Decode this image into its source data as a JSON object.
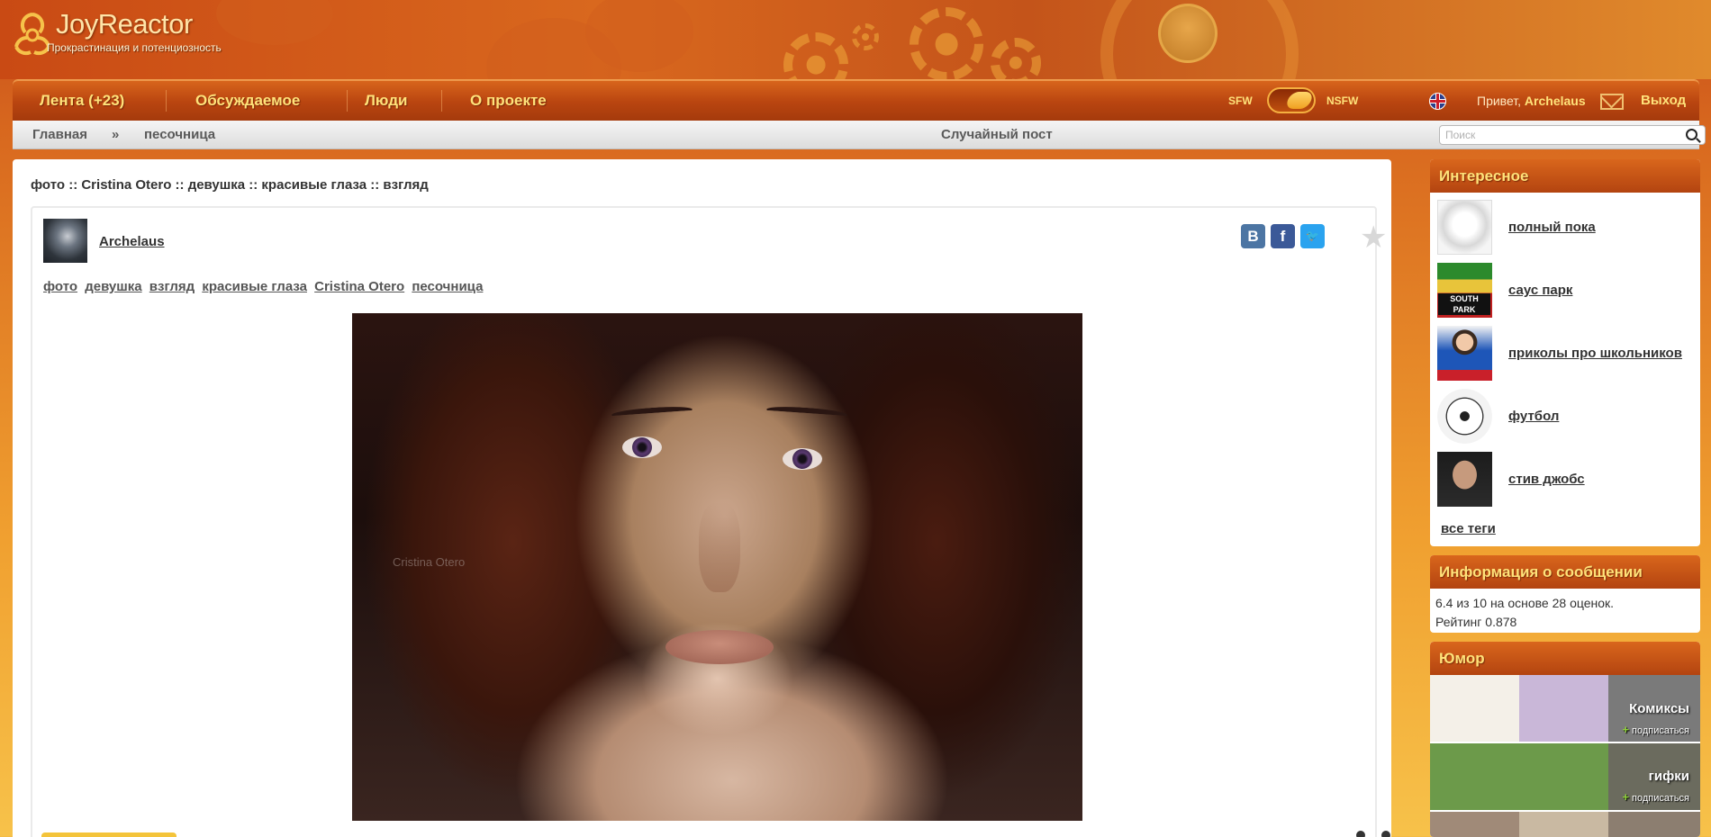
{
  "header": {
    "logo_title": "JoyReactor",
    "logo_subtitle": "Прокрастинация и потенциозность"
  },
  "nav": {
    "items": [
      {
        "label": "Лента (+23)"
      },
      {
        "label": "Обсуждаемое"
      },
      {
        "label": "Люди"
      },
      {
        "label": "О проекте"
      }
    ],
    "sfw_label": "SFW",
    "nsfw_label": "NSFW",
    "greeting": "Привет,",
    "username": "Archelaus",
    "logout_label": "Выход"
  },
  "crumbs": {
    "home": "Главная",
    "separator": "»",
    "current": "песочница",
    "random_post": "Случайный пост",
    "search_placeholder": "Поиск"
  },
  "post": {
    "title": "фото :: Cristina Otero :: девушка :: красивые глаза :: взгляд",
    "author": "Archelaus",
    "tags": [
      "фото",
      "девушка",
      "взгляд",
      "красивые глаза",
      "Cristina Otero",
      "песочница"
    ],
    "share": {
      "vk": "B",
      "fb": "f",
      "tw": "🐦"
    },
    "watermark": "Cristina Otero"
  },
  "sidebar": {
    "interesting": {
      "title": "Интересное",
      "items": [
        {
          "label": "полный пока"
        },
        {
          "label": "саус парк"
        },
        {
          "label": "приколы про школьников"
        },
        {
          "label": "футбол"
        },
        {
          "label": "стив джобс"
        }
      ],
      "all_tags": "все теги"
    },
    "info": {
      "title": "Информация о сообщении",
      "line1": "6.4 из 10 на основе 28 оценок.",
      "line2": "Рейтинг 0.878"
    },
    "humor": {
      "title": "Юмор",
      "items": [
        {
          "title": "Комиксы",
          "subscribe": "подписаться"
        },
        {
          "title": "гифки",
          "subscribe": "подписаться"
        }
      ]
    }
  },
  "colors": {
    "accent": "#ffe27a",
    "nav_bg": "#b94510",
    "page_bg": "#f0a030"
  }
}
